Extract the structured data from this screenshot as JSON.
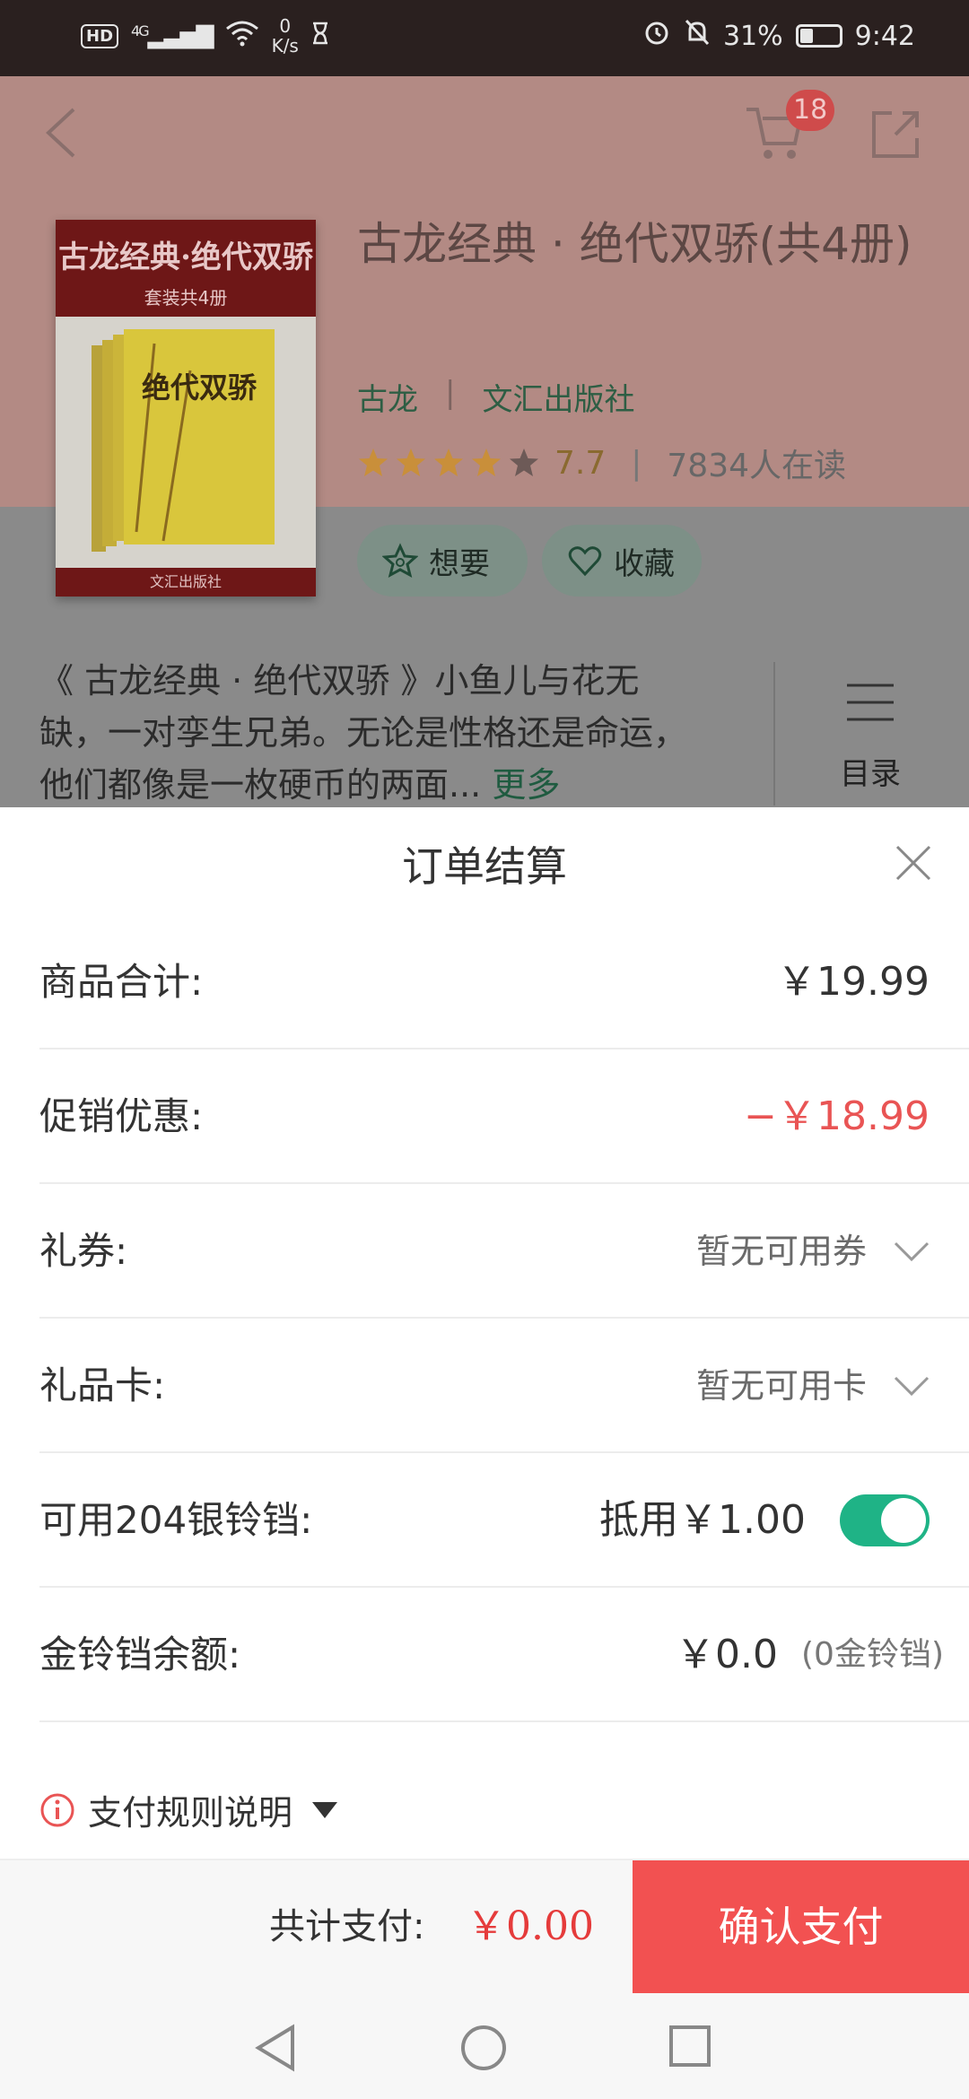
{
  "status_bar": {
    "hd": "HD",
    "network": "4G",
    "speed_value": "0",
    "speed_unit": "K/s",
    "battery_percent": "31%",
    "battery_level": 0.31,
    "time": "9:42"
  },
  "header": {
    "cart_count": "18"
  },
  "book": {
    "cover_title": "古龙经典·绝代双骄",
    "cover_subtitle": "套装共4册",
    "cover_box_text": "绝代双骄",
    "cover_publisher": "文汇出版社",
    "title": "古龙经典 · 绝代双骄(共4册)",
    "author": "古龙",
    "publisher": "文汇出版社",
    "rating_stars": 4,
    "rating_max": 5,
    "score": "7.7",
    "readers": "7834人在读",
    "want_label": "想要",
    "fav_label": "收藏",
    "description": "《 古龙经典 · 绝代双骄 》小鱼儿与花无缺，一对孪生兄弟。无论是性格还是命运，他们都像是一枚硬币的两面...",
    "more_label": "更多",
    "toc_label": "目录"
  },
  "sheet": {
    "title": "订单结算",
    "rows": [
      {
        "label": "商品合计:",
        "value": "￥19.99"
      },
      {
        "label": "促销优惠:",
        "value": "−￥18.99"
      },
      {
        "label": "礼券:",
        "value": "暂无可用券"
      },
      {
        "label": "礼品卡:",
        "value": "暂无可用卡"
      },
      {
        "label": "可用204银铃铛:",
        "value": "抵用￥1.00",
        "toggle_on": true
      },
      {
        "label": "金铃铛余额:",
        "value": "￥0.0",
        "sub": "(0金铃铛)"
      }
    ],
    "rules_label": "支付规则说明"
  },
  "footer": {
    "total_label": "共计支付:",
    "total_value": "￥0.00",
    "pay_button": "确认支付"
  },
  "colors": {
    "accent_green": "#1fb386",
    "price_red": "#e95454",
    "pay_button": "#f25151"
  }
}
